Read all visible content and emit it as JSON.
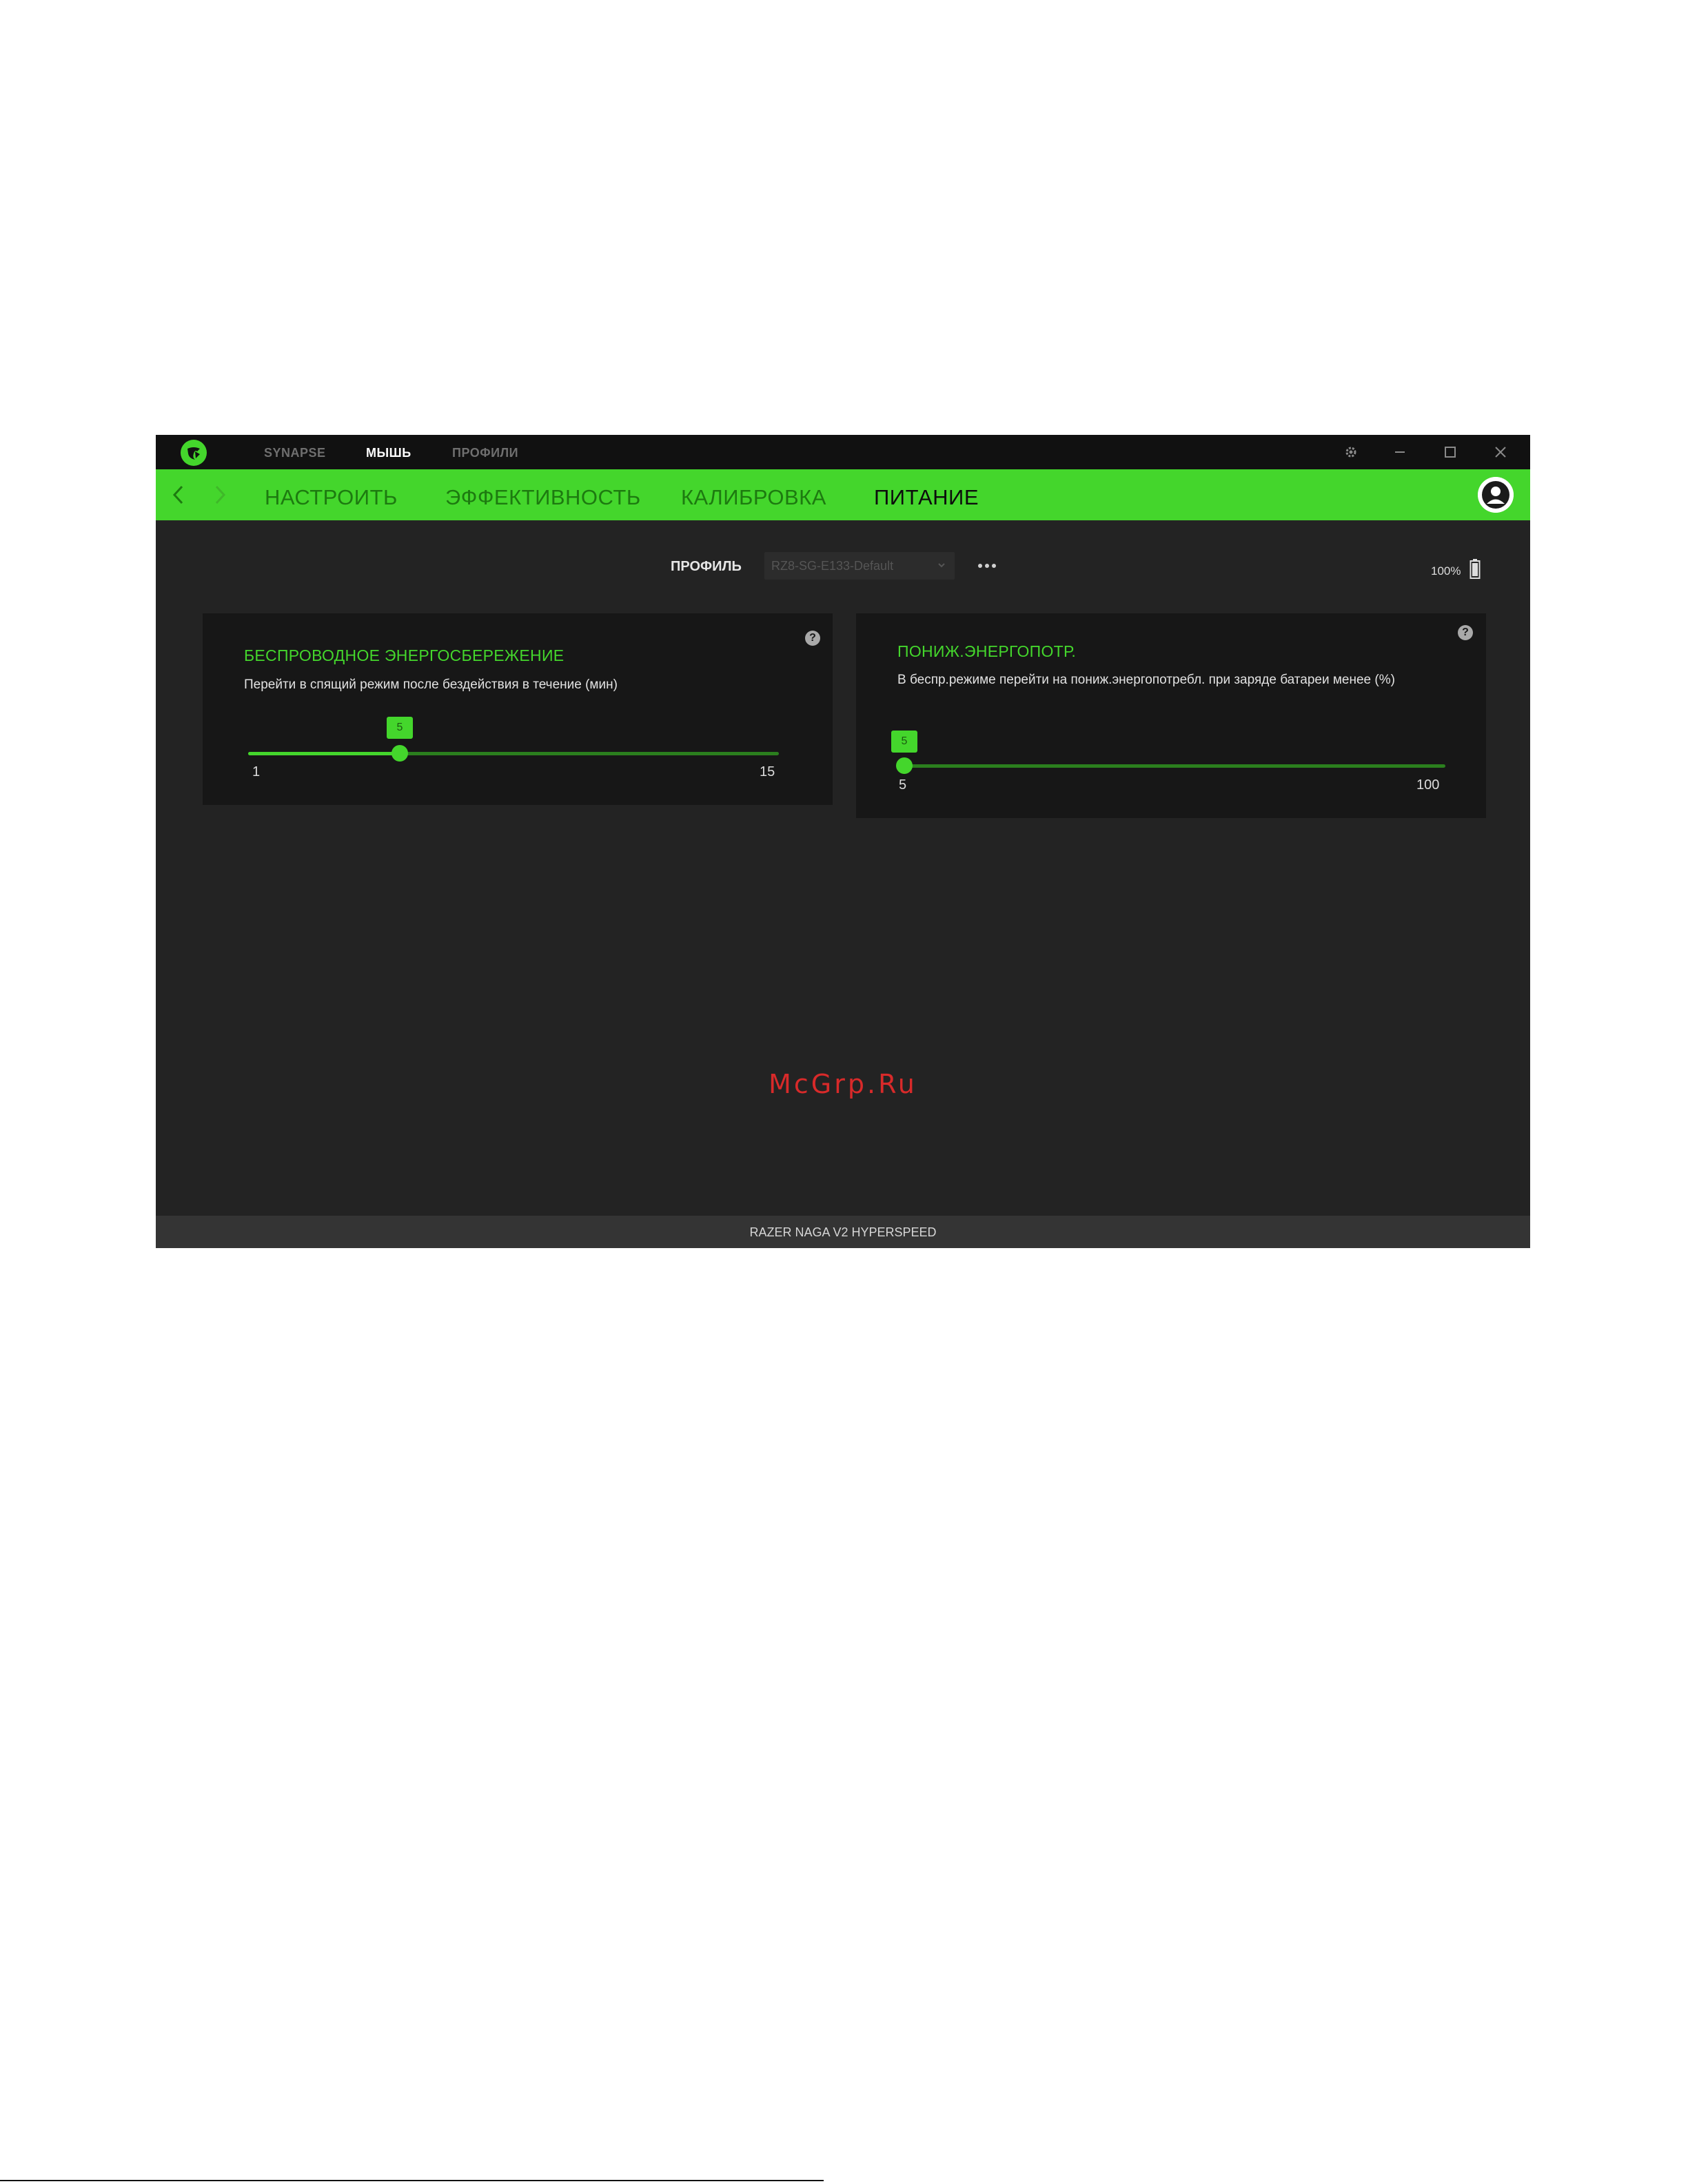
{
  "window": {
    "top_tabs": [
      "SYNAPSE",
      "МЫШЬ",
      "ПРОФИЛИ"
    ],
    "active_top_tab": "МЫШЬ"
  },
  "nav": {
    "tabs": [
      "НАСТРОИТЬ",
      "ЭФФЕКТИВНОСТЬ",
      "КАЛИБРОВКА",
      "ПИТАНИЕ"
    ],
    "active_tab": "ПИТАНИЕ"
  },
  "profile": {
    "label": "ПРОФИЛЬ",
    "value": "RZ8-SG-E133-Default",
    "more": "•••"
  },
  "battery": {
    "text": "100%",
    "level": 1.0
  },
  "cards": [
    {
      "title": "БЕСПРОВОДНОЕ ЭНЕРГОСБЕРЕЖЕНИЕ",
      "description": "Перейти в спящий режим после бездействия в течение (мин)",
      "slider": {
        "min": 1,
        "max": 15,
        "value": 5,
        "min_label": "1",
        "max_label": "15",
        "value_label": "5"
      },
      "help": "?"
    },
    {
      "title": "ПОНИЖ.ЭНЕРГОПОТР.",
      "description": "В беспр.режиме перейти на пониж.энергопотребл. при заряде батареи менее (%)",
      "slider": {
        "min": 5,
        "max": 100,
        "value": 5,
        "min_label": "5",
        "max_label": "100",
        "value_label": "5"
      },
      "help": "?"
    }
  ],
  "watermark": "McGrp.Ru",
  "device_name": "RAZER NAGA V2 HYPERSPEED",
  "colors": {
    "accent": "#44d62c",
    "background": "#232323",
    "card": "#171717",
    "titlebar": "#111111"
  }
}
